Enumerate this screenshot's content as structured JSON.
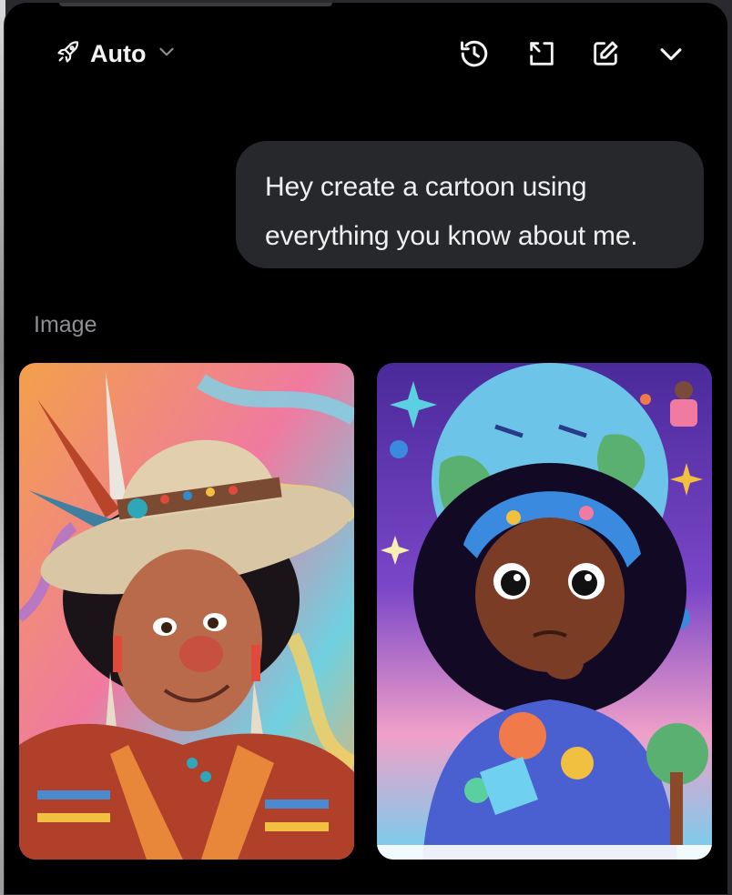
{
  "header": {
    "model_label": "Auto",
    "icons": [
      "rocket-icon",
      "chevron-down-icon",
      "history-icon",
      "expand-icon",
      "compose-icon",
      "collapse-chevron-icon"
    ]
  },
  "conversation": {
    "user_message": "Hey create a cartoon using everything you know about me."
  },
  "results": {
    "section_label": "Image",
    "images": [
      {
        "subject": "cartoon man with feathered hat"
      },
      {
        "subject": "cartoon girl with curly hair and headband"
      }
    ]
  },
  "colors": {
    "panel_bg": "#000000",
    "bubble_bg": "#26282b",
    "text_primary": "#f0f0f0",
    "text_muted": "#8e8e93"
  }
}
